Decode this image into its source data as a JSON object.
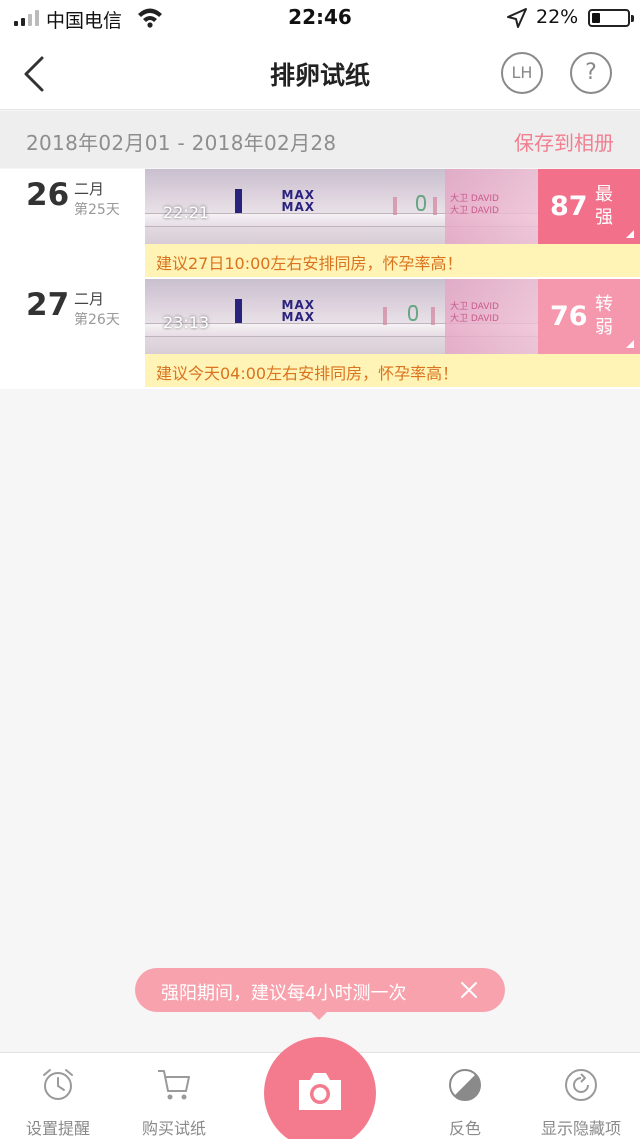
{
  "status_bar": {
    "carrier": "中国电信",
    "time": "22:46",
    "battery": "22%"
  },
  "nav": {
    "title": "排卵试纸",
    "lh_label": "LH",
    "help_label": "?"
  },
  "range": {
    "text": "2018年02月01 - 2018年02月28",
    "save_label": "保存到相册"
  },
  "records": [
    {
      "day": "26",
      "month": "二月",
      "cycle_day": "第25天",
      "time": "22:21",
      "score": "87",
      "level": "最强",
      "score_color": "#f2708a",
      "advice": "建议27日10:00左右安排同房，怀孕率高！"
    },
    {
      "day": "27",
      "month": "二月",
      "cycle_day": "第26天",
      "time": "23:13",
      "score": "76",
      "level": "转弱",
      "score_color": "#f598ae",
      "advice": "建议今天04:00左右安排同房，怀孕率高！"
    }
  ],
  "strip": {
    "max_label": "MAX",
    "brand_text": "大卫 DAVID"
  },
  "tooltip": {
    "text": "强阳期间，建议每4小时测一次"
  },
  "toolbar": {
    "reminder_label": "设置提醒",
    "buy_label": "购买试纸",
    "invert_label": "反色",
    "show_hidden_label": "显示隐藏项"
  },
  "icons": {
    "back": "chevron-left-icon",
    "reminder": "alarm-clock-icon",
    "buy": "shopping-cart-icon",
    "camera": "camera-icon",
    "invert": "invert-color-icon",
    "show_hidden": "refresh-circle-icon",
    "close": "close-icon"
  },
  "colors": {
    "accent": "#f47b8d",
    "advice_bg": "#fff3b6",
    "advice_text": "#d9731e"
  }
}
